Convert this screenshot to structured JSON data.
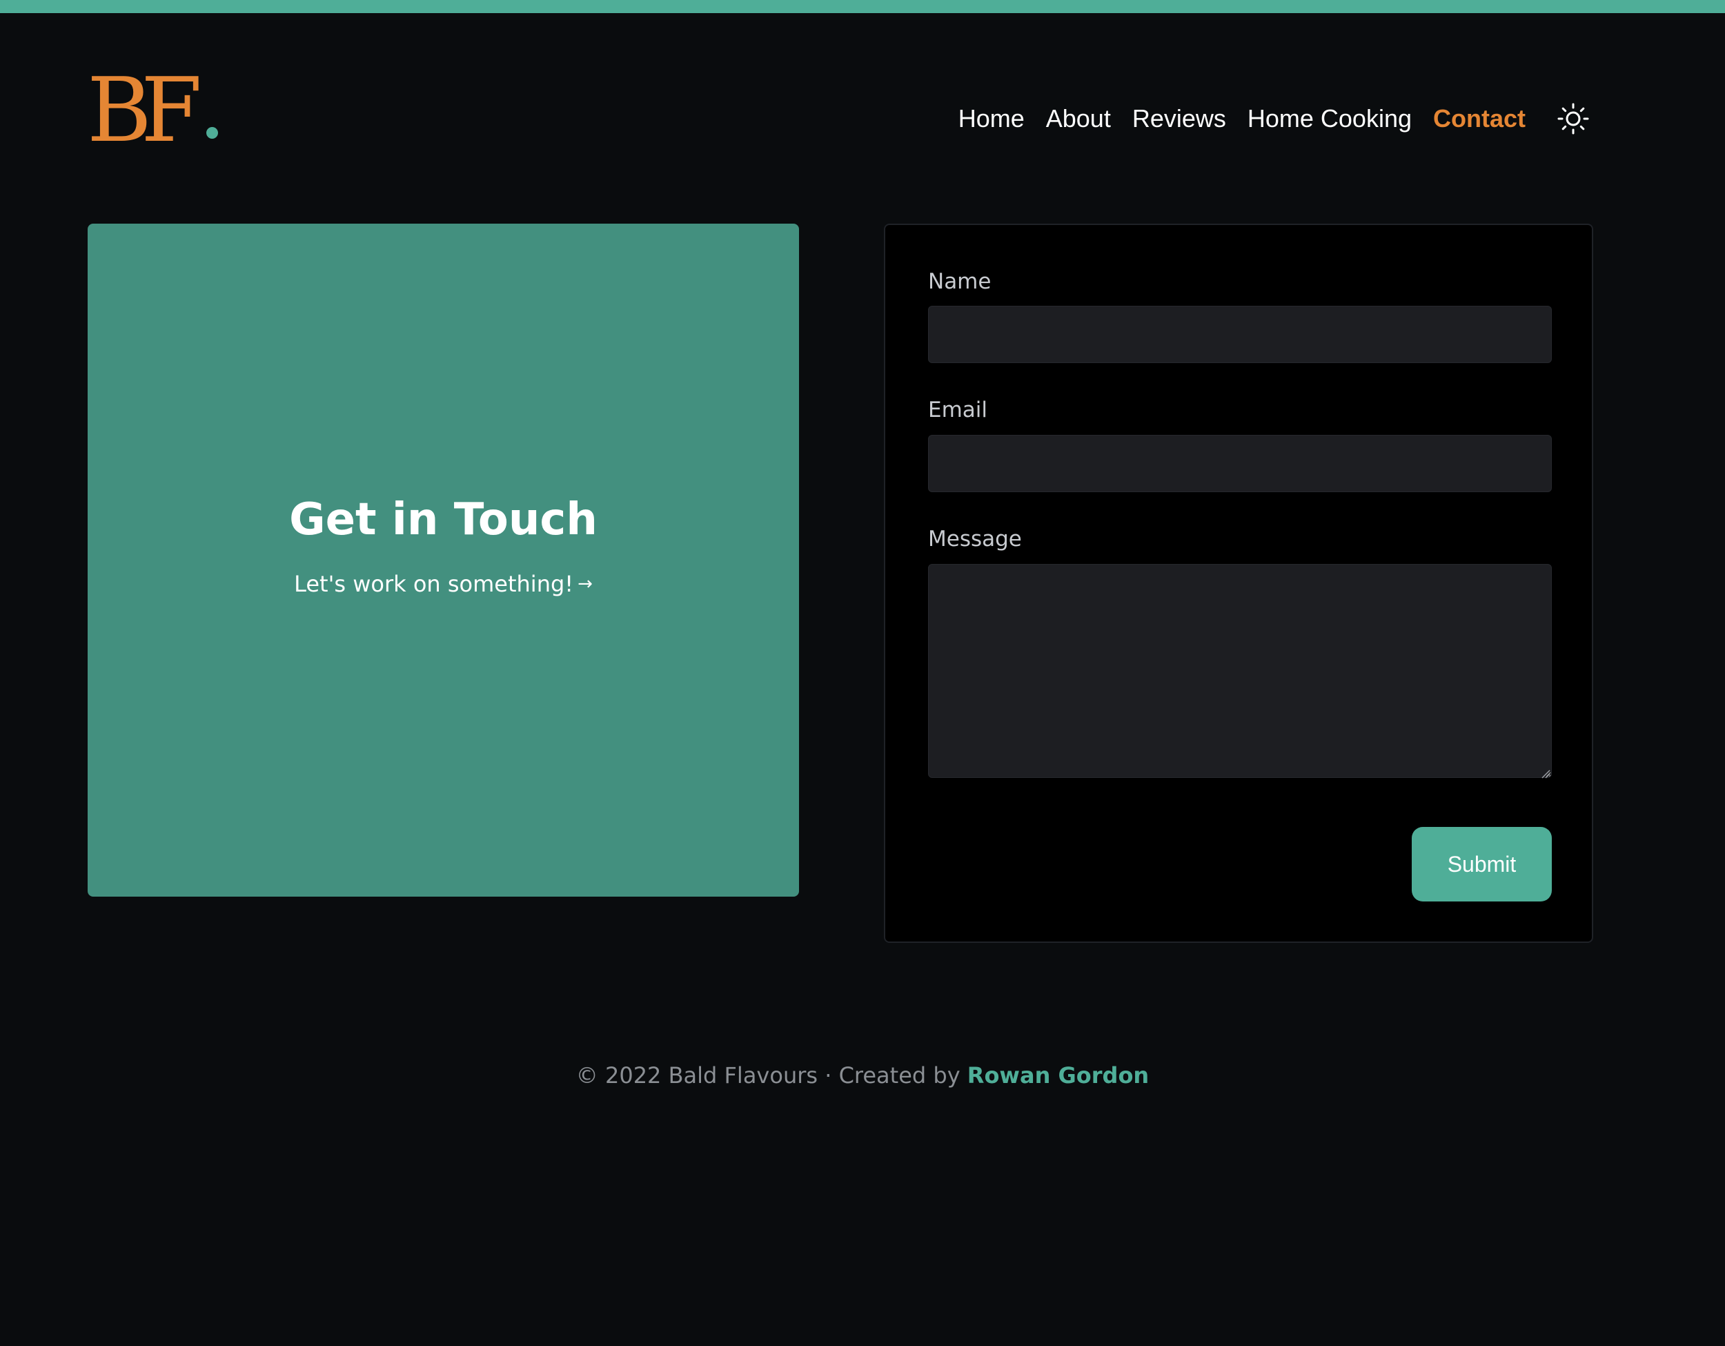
{
  "brand": {
    "logo_text": "BF",
    "primary_color": "#e58634",
    "accent_color": "#4fae98",
    "background_color": "#0a0c0e"
  },
  "nav": {
    "items": [
      {
        "label": "Home",
        "active": false
      },
      {
        "label": "About",
        "active": false
      },
      {
        "label": "Reviews",
        "active": false
      },
      {
        "label": "Home Cooking",
        "active": false
      },
      {
        "label": "Contact",
        "active": true
      }
    ],
    "theme_toggle_icon": "sun-icon"
  },
  "hero": {
    "title": "Get in Touch",
    "link_text": "Let's work on something!",
    "link_arrow": "→",
    "card_color": "#43907f"
  },
  "form": {
    "name_label": "Name",
    "name_value": "",
    "email_label": "Email",
    "email_value": "",
    "message_label": "Message",
    "message_value": "",
    "submit_label": "Submit"
  },
  "footer": {
    "text": "© 2022 Bald Flavours · Created by",
    "author": "Rowan Gordon"
  }
}
